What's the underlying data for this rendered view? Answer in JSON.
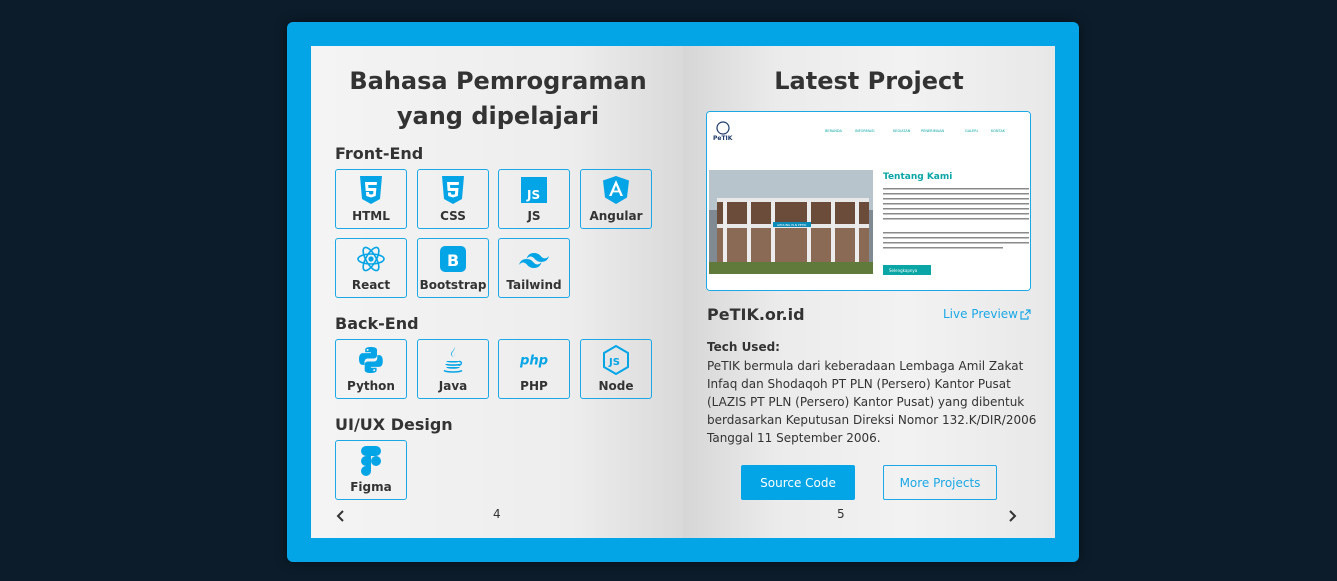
{
  "left_page": {
    "title_line1": "Bahasa Pemrograman",
    "title_line2": "yang dipelajari",
    "page_number": "4",
    "sections": {
      "frontend": {
        "title": "Front-End",
        "items": [
          {
            "label": "HTML",
            "icon": "html5-icon"
          },
          {
            "label": "CSS",
            "icon": "css3-icon"
          },
          {
            "label": "JS",
            "icon": "javascript-icon"
          },
          {
            "label": "Angular",
            "icon": "angular-icon"
          },
          {
            "label": "React",
            "icon": "react-icon"
          },
          {
            "label": "Bootstrap",
            "icon": "bootstrap-icon"
          },
          {
            "label": "Tailwind",
            "icon": "tailwind-icon"
          }
        ]
      },
      "backend": {
        "title": "Back-End",
        "items": [
          {
            "label": "Python",
            "icon": "python-icon"
          },
          {
            "label": "Java",
            "icon": "java-icon"
          },
          {
            "label": "PHP",
            "icon": "php-icon"
          },
          {
            "label": "Node",
            "icon": "nodejs-icon"
          }
        ]
      },
      "uiux": {
        "title": "UI/UX Design",
        "items": [
          {
            "label": "Figma",
            "icon": "figma-icon"
          }
        ]
      }
    }
  },
  "right_page": {
    "title": "Latest Project",
    "page_number": "5",
    "project": {
      "name": "PeTIK.or.id",
      "live_preview": "Live Preview",
      "tech_used_label": "Tech Used:",
      "description": "PeTIK bermula dari keberadaan Lembaga Amil Zakat Infaq dan Shodaqoh PT PLN (Persero) Kantor Pusat (LAZIS PT PLN (Persero) Kantor Pusat) yang dibentuk berdasarkan Keputusan Direksi Nomor 132.K/DIR/2006 Tanggal 11 September 2006.",
      "screenshot": {
        "logo": "PeTIK",
        "nav": [
          "BERANDA",
          "INFORMASI",
          "KEGIATAN",
          "PENERIMAAN",
          "GALERI",
          "KONTAK"
        ],
        "heading": "Tentang Kami",
        "building_sign": "GEDUNG PLN PETIK",
        "cta": "Selengkapnya"
      }
    },
    "buttons": {
      "source_code": "Source Code",
      "more_projects": "More Projects"
    }
  },
  "colors": {
    "accent": "#04a5e6",
    "background": "#0c1c2a",
    "text": "#333333"
  }
}
